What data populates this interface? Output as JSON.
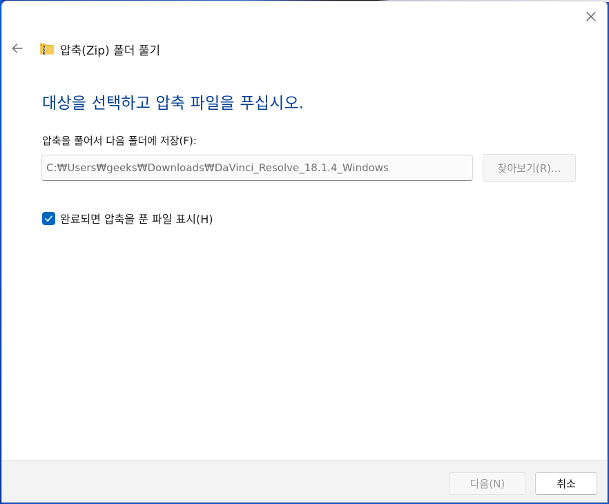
{
  "window": {
    "title": "압축(Zip) 폴더 풀기",
    "close_icon": "close-icon",
    "back_icon": "back-arrow-icon",
    "title_icon": "zip-folder-icon"
  },
  "main": {
    "headline": "대상을 선택하고 압축 파일을 푸십시오.",
    "destination_label": "압축을 풀어서 다음 폴더에 저장(F):",
    "destination_path": "C:₩Users₩geeks₩Downloads₩DaVinci_Resolve_18.1.4_Windows",
    "browse_label": "찾아보기(R)...",
    "show_files_checked": true,
    "show_files_label": "완료되면 압축을 푼 파일 표시(H)"
  },
  "footer": {
    "next_label": "다음(N)",
    "cancel_label": "취소"
  },
  "colors": {
    "accent": "#0067c0",
    "headline": "#003e92"
  }
}
